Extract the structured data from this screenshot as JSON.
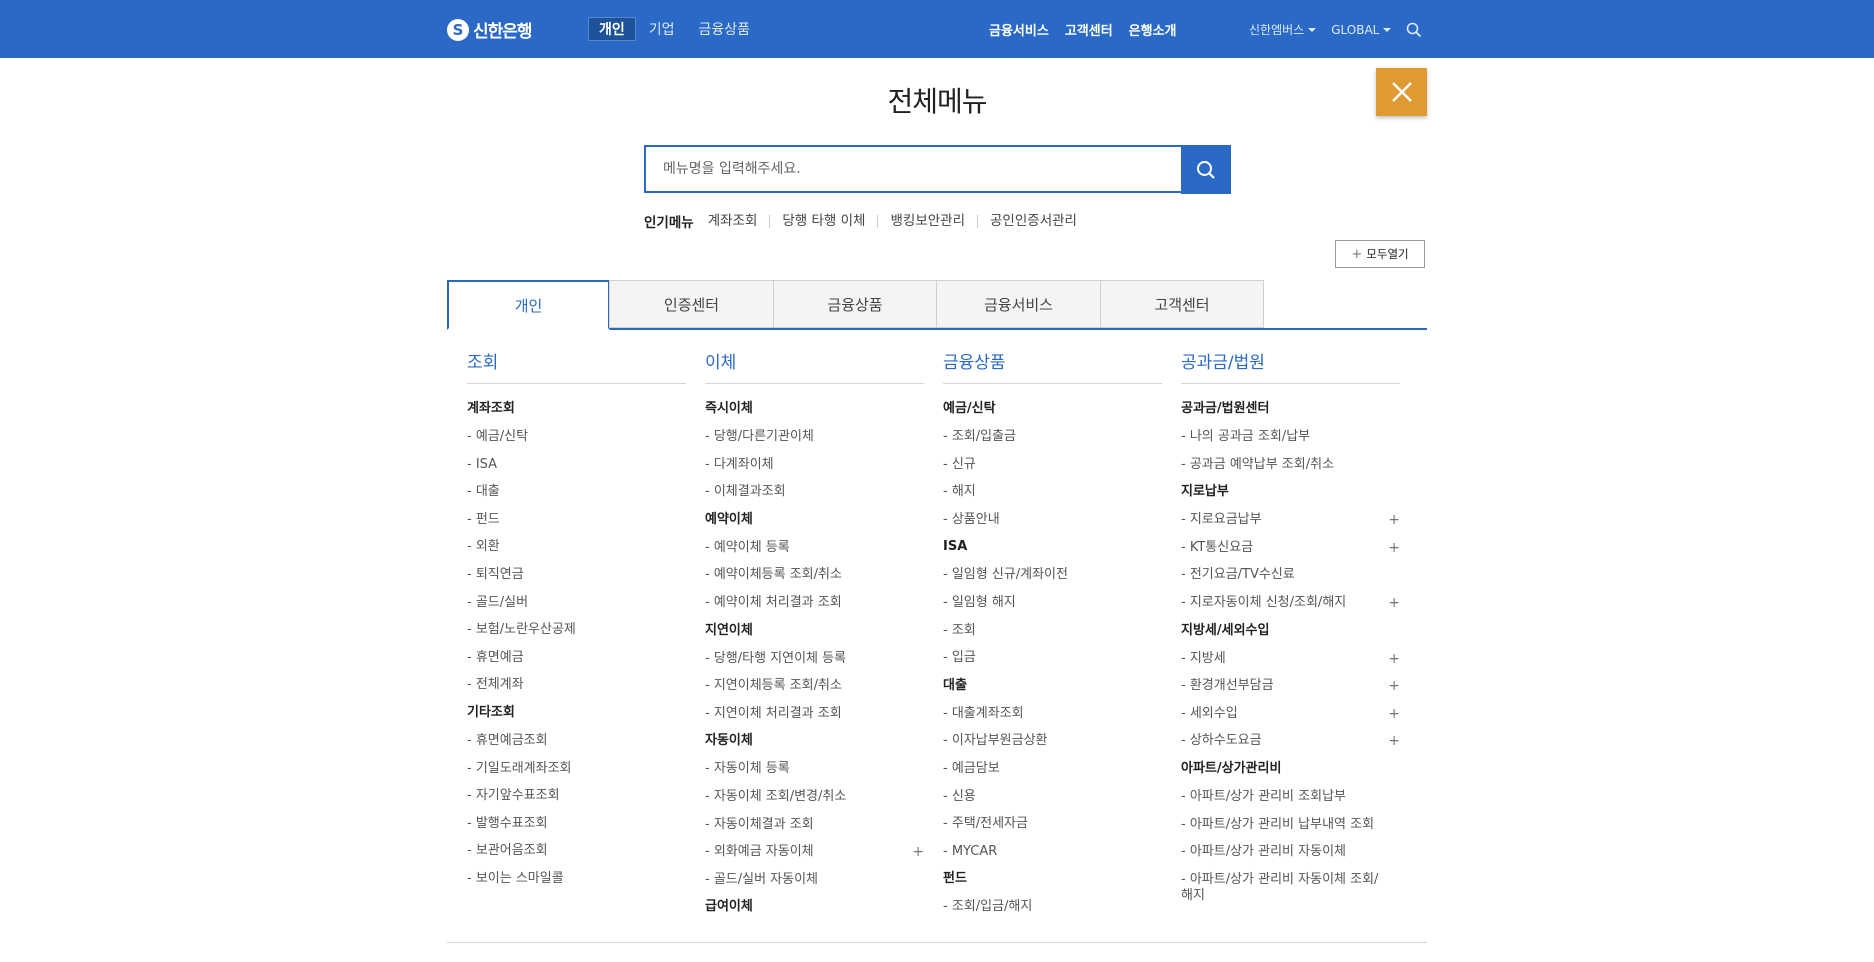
{
  "header": {
    "logo_text": "신한은행",
    "main_nav": [
      "개인",
      "기업",
      "금융상품"
    ],
    "util_nav": [
      "금융서비스",
      "고객센터",
      "은행소개"
    ],
    "right_nav": [
      "신한엠버스",
      "GLOBAL"
    ]
  },
  "panel": {
    "title": "전체메뉴",
    "search_placeholder": "메뉴명을 입력해주세요.",
    "popular_label": "인기메뉴",
    "popular": [
      "계좌조회",
      "당행 타행 이체",
      "뱅킹보안관리",
      "공인인증서관리"
    ],
    "expand_all": "모두열기",
    "tabs": [
      "개인",
      "인증센터",
      "금융상품",
      "금융서비스",
      "고객센터"
    ],
    "columns": [
      {
        "title": "조회",
        "groups": [
          {
            "name": "계좌조회",
            "items": [
              "- 예금/신탁",
              "- ISA",
              "- 대출",
              "- 펀드",
              "- 외환",
              "- 퇴직연금",
              "- 골드/실버",
              "- 보험/노란우산공제",
              "- 휴면예금",
              "- 전체계좌"
            ]
          },
          {
            "name": "기타조회",
            "items": [
              "- 휴면예금조회",
              "- 기일도래계좌조회",
              "- 자기앞수표조회",
              "- 발행수표조회",
              "- 보관어음조회",
              "- 보이는 스마일콜"
            ]
          }
        ]
      },
      {
        "title": "이체",
        "groups": [
          {
            "name": "즉시이체",
            "items": [
              "- 당행/다른기관이체",
              "- 다계좌이체",
              "- 이체결과조회"
            ]
          },
          {
            "name": "예약이체",
            "items": [
              "- 예약이체 등록",
              "- 예약이체등록 조회/취소",
              "- 예약이체 처리결과 조회"
            ]
          },
          {
            "name": "지연이체",
            "items": [
              "- 당행/타행 지연이체 등록",
              "- 지연이체등록 조회/취소",
              "- 지연이체 처리결과 조회"
            ]
          },
          {
            "name": "자동이체",
            "items": [
              "- 자동이체 등록",
              "- 자동이체 조회/변경/취소",
              "- 자동이체결과 조회",
              "- 외화예금 자동이체 +",
              "- 골드/실버 자동이체"
            ]
          },
          {
            "name": "급여이체",
            "items": []
          }
        ]
      },
      {
        "title": "금융상품",
        "groups": [
          {
            "name": "예금/신탁",
            "items": [
              "- 조회/입출금",
              "- 신규",
              "- 해지",
              "- 상품안내"
            ]
          },
          {
            "name": "ISA",
            "items": [
              "- 일임형 신규/계좌이전",
              "- 일임형 해지",
              "- 조회",
              "- 입금"
            ]
          },
          {
            "name": "대출",
            "items": [
              "- 대출계좌조회",
              "- 이자납부원금상환",
              "- 예금담보",
              "- 신용",
              "- 주택/전세자금",
              "- MYCAR"
            ]
          },
          {
            "name": "펀드",
            "items": [
              "- 조회/입금/해지"
            ]
          }
        ]
      },
      {
        "title": "공과금/법원",
        "groups": [
          {
            "name": "공과금/법원센터",
            "items": [
              "- 나의 공과금 조회/납부",
              "- 공과금 예약납부 조회/취소"
            ]
          },
          {
            "name": "지로납부",
            "items": [
              "- 지로요금납부 +",
              "- KT통신요금 +",
              "- 전기요금/TV수신료",
              "- 지로자동이체 신청/조회/해지 +"
            ]
          },
          {
            "name": "지방세/세외수입",
            "items": [
              "- 지방세 +",
              "- 환경개선부담금 +",
              "- 세외수입 +",
              "- 상하수도요금 +"
            ]
          },
          {
            "name": "아파트/상가관리비",
            "items": [
              "- 아파트/상가 관리비 조회납부",
              "- 아파트/상가 관리비 납부내역 조회",
              "- 아파트/상가 관리비 자동이체",
              "- 아파트/상가 관리비 자동이체 조회/ 해지"
            ]
          }
        ]
      }
    ]
  },
  "colors": {
    "primary": "#2a6ac6",
    "close": "#e09a34"
  },
  "icons": {
    "close": "close-icon",
    "search": "search-icon",
    "logo": "shinhan-logo-icon"
  }
}
